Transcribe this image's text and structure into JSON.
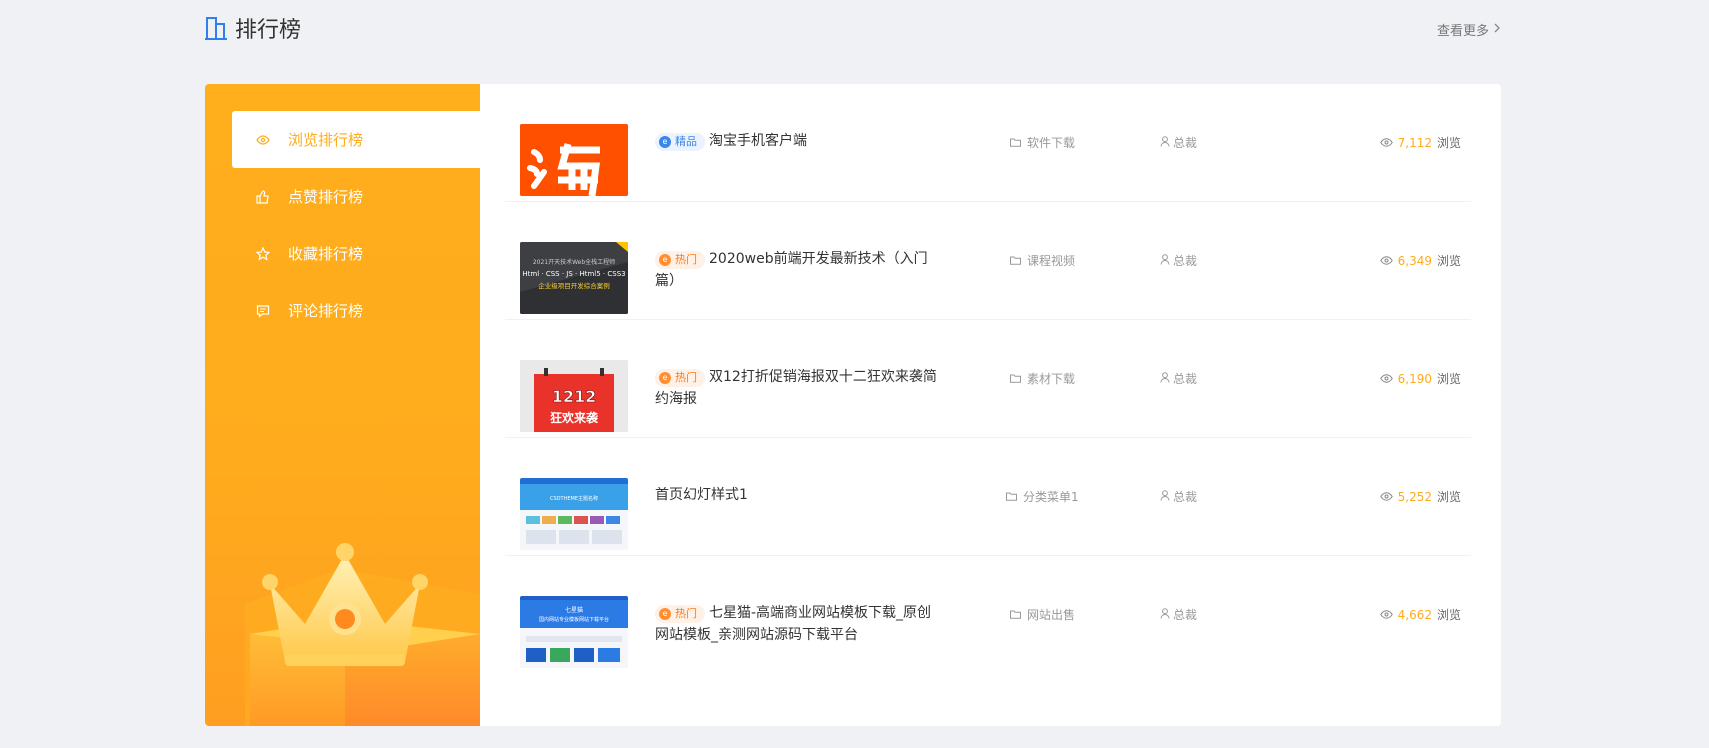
{
  "header": {
    "title": "排行榜",
    "more": "查看更多"
  },
  "sidebar": {
    "items": [
      {
        "label": "浏览排行榜",
        "icon": "eye-icon",
        "active": true
      },
      {
        "label": "点赞排行榜",
        "icon": "thumbs-up-icon",
        "active": false
      },
      {
        "label": "收藏排行榜",
        "icon": "star-icon",
        "active": false
      },
      {
        "label": "评论排行榜",
        "icon": "comment-icon",
        "active": false
      }
    ]
  },
  "list": {
    "rows": [
      {
        "badge": "精品",
        "badge_type": "jing",
        "title": "淘宝手机客户端",
        "category": "软件下载",
        "author": "总裁",
        "views": "7,112",
        "views_label": "浏览",
        "thumb": "taobao"
      },
      {
        "badge": "热门",
        "badge_type": "re",
        "title": "2020web前端开发最新技术（入门篇）",
        "category": "课程视频",
        "author": "总裁",
        "views": "6,349",
        "views_label": "浏览",
        "thumb": "web",
        "thumb_text": [
          "2021开天技术Web全栈工程师",
          "Html · CSS · JS · Html5 · CSS3",
          "企业级项目开发综合案例"
        ]
      },
      {
        "badge": "热门",
        "badge_type": "re",
        "title": "双12打折促销海报双十二狂欢来袭简约海报",
        "category": "素材下载",
        "author": "总裁",
        "views": "6,190",
        "views_label": "浏览",
        "thumb": "poster",
        "thumb_text": [
          "1212",
          "狂欢来袭"
        ]
      },
      {
        "badge": "",
        "badge_type": "",
        "title": "首页幻灯样式1",
        "category": "分类菜单1",
        "author": "总裁",
        "views": "5,252",
        "views_label": "浏览",
        "thumb": "slider",
        "thumb_text": [
          "CSDTHEME主题名称"
        ]
      },
      {
        "badge": "热门",
        "badge_type": "re",
        "title": "七星猫-高端商业网站模板下载_原创网站模板_亲测网站源码下载平台",
        "category": "网站出售",
        "author": "总裁",
        "views": "4,662",
        "views_label": "浏览",
        "thumb": "site",
        "thumb_text": [
          "七星猫",
          "国内网站专业模板网站下载平台"
        ]
      }
    ]
  },
  "colors": {
    "accent": "#ffab1d",
    "badge_blue": "#3b87e6",
    "badge_orange": "#ff7a1c"
  }
}
